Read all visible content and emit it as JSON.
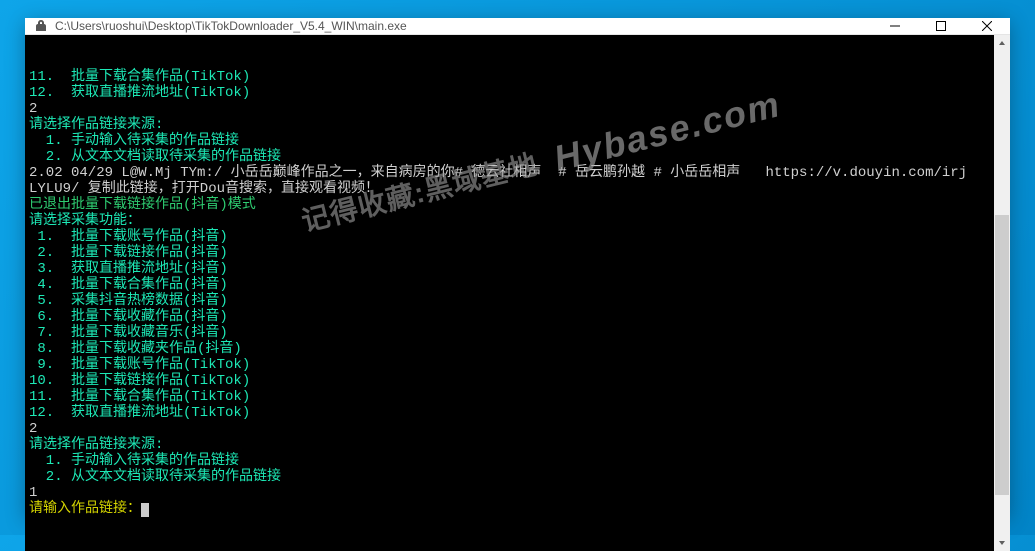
{
  "titlebar": {
    "title": "C:\\Users\\ruoshui\\Desktop\\TikTokDownloader_V5.4_WIN\\main.exe"
  },
  "lines": [
    {
      "segments": [
        {
          "cls": "cyan",
          "text": "11.  批量下载合集作品(TikTok)"
        }
      ]
    },
    {
      "segments": [
        {
          "cls": "cyan",
          "text": "12.  获取直播推流地址(TikTok)"
        }
      ]
    },
    {
      "segments": [
        {
          "cls": "gray",
          "text": "2"
        }
      ]
    },
    {
      "segments": [
        {
          "cls": "cyan",
          "text": "请选择作品链接来源:"
        }
      ]
    },
    {
      "segments": [
        {
          "cls": "cyan",
          "text": "  1. 手动输入待采集的作品链接"
        }
      ]
    },
    {
      "segments": [
        {
          "cls": "cyan",
          "text": "  2. 从文本文档读取待采集的作品链接"
        }
      ]
    },
    {
      "segments": [
        {
          "cls": "gray",
          "text": "2.02 04/29 L@W.Mj TYm:/ 小岳岳巅峰作品之一，来自病房的你# 德云社相声  # 岳云鹏孙越 # 小岳岳相声   https://v.douyin.com/irj"
        }
      ]
    },
    {
      "segments": [
        {
          "cls": "gray",
          "text": "LYLU9/ 复制此链接，打开Dou音搜索，直接观看视频！"
        }
      ]
    },
    {
      "segments": [
        {
          "cls": "green",
          "text": "已退出批量下载链接作品(抖音)模式"
        }
      ]
    },
    {
      "segments": [
        {
          "cls": "cyan",
          "text": "请选择采集功能："
        }
      ]
    },
    {
      "segments": [
        {
          "cls": "cyan",
          "text": " 1.  批量下载账号作品(抖音)"
        }
      ]
    },
    {
      "segments": [
        {
          "cls": "cyan",
          "text": " 2.  批量下载链接作品(抖音)"
        }
      ]
    },
    {
      "segments": [
        {
          "cls": "cyan",
          "text": " 3.  获取直播推流地址(抖音)"
        }
      ]
    },
    {
      "segments": [
        {
          "cls": "cyan",
          "text": " 4.  批量下载合集作品(抖音)"
        }
      ]
    },
    {
      "segments": [
        {
          "cls": "cyan",
          "text": " 5.  采集抖音热榜数据(抖音)"
        }
      ]
    },
    {
      "segments": [
        {
          "cls": "cyan",
          "text": " 6.  批量下载收藏作品(抖音)"
        }
      ]
    },
    {
      "segments": [
        {
          "cls": "cyan",
          "text": " 7.  批量下载收藏音乐(抖音)"
        }
      ]
    },
    {
      "segments": [
        {
          "cls": "cyan",
          "text": " 8.  批量下载收藏夹作品(抖音)"
        }
      ]
    },
    {
      "segments": [
        {
          "cls": "cyan",
          "text": " 9.  批量下载账号作品(TikTok)"
        }
      ]
    },
    {
      "segments": [
        {
          "cls": "cyan",
          "text": "10.  批量下载链接作品(TikTok)"
        }
      ]
    },
    {
      "segments": [
        {
          "cls": "cyan",
          "text": "11.  批量下载合集作品(TikTok)"
        }
      ]
    },
    {
      "segments": [
        {
          "cls": "cyan",
          "text": "12.  获取直播推流地址(TikTok)"
        }
      ]
    },
    {
      "segments": [
        {
          "cls": "gray",
          "text": "2"
        }
      ]
    },
    {
      "segments": [
        {
          "cls": "cyan",
          "text": "请选择作品链接来源:"
        }
      ]
    },
    {
      "segments": [
        {
          "cls": "cyan",
          "text": "  1. 手动输入待采集的作品链接"
        }
      ]
    },
    {
      "segments": [
        {
          "cls": "cyan",
          "text": "  2. 从文本文档读取待采集的作品链接"
        }
      ]
    },
    {
      "segments": [
        {
          "cls": "gray",
          "text": "1"
        }
      ]
    },
    {
      "segments": [
        {
          "cls": "yellow",
          "text": "请输入作品链接："
        }
      ],
      "cursor": true
    }
  ],
  "watermark": {
    "cn": "记得收藏:黑域基地",
    "en": "Hybase.com"
  }
}
